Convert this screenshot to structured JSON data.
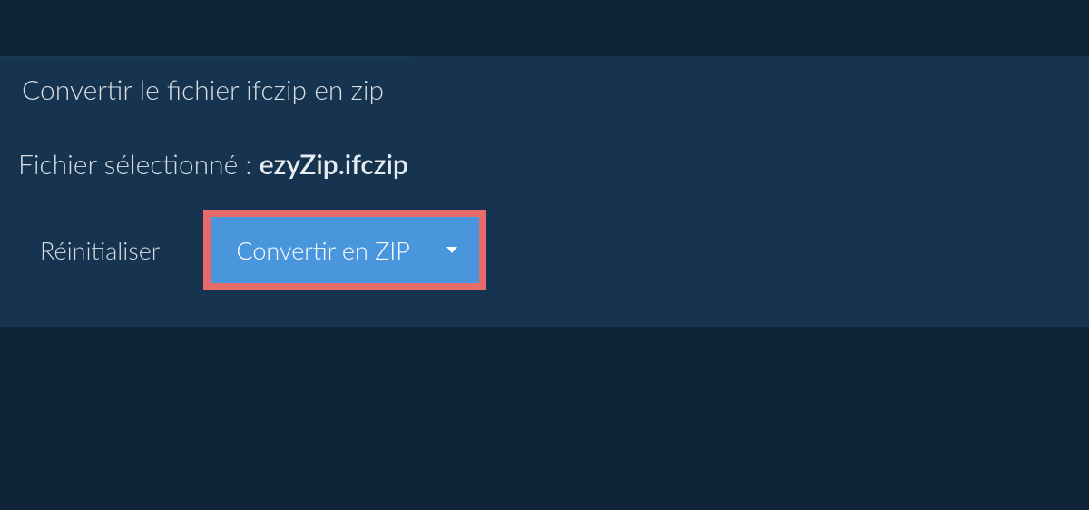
{
  "tab": {
    "title": "Convertir le fichier ifczip en zip"
  },
  "selectedFile": {
    "label": "Fichier sélectionné : ",
    "filename": "ezyZip.ifczip"
  },
  "buttons": {
    "reset": "Réinitialiser",
    "convert": "Convertir en ZIP"
  },
  "colors": {
    "pageBackground": "#0f2337",
    "panelBackground": "#163450",
    "primaryButton": "#4a96dd",
    "highlightBorder": "#e86b6b",
    "text": "#d8dde2"
  }
}
